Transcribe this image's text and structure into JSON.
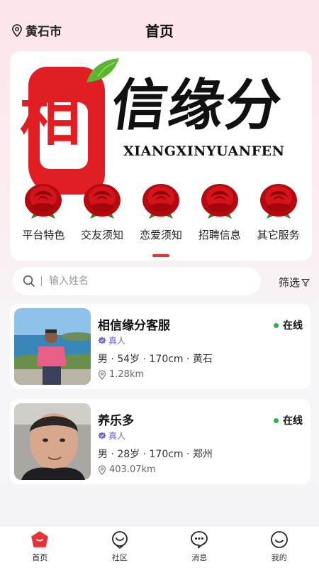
{
  "header": {
    "location": "黄石市",
    "title": "首页"
  },
  "banner": {
    "seal_char": "相",
    "title": "信缘分",
    "pinyin": "XIANGXINYUANFEN"
  },
  "menu": {
    "items": [
      {
        "label": "平台特色",
        "icon": "rose-icon"
      },
      {
        "label": "交友须知",
        "icon": "rose-icon"
      },
      {
        "label": "恋爱须知",
        "icon": "rose-icon"
      },
      {
        "label": "招聘信息",
        "icon": "rose-icon"
      },
      {
        "label": "其它服务",
        "icon": "rose-icon"
      }
    ]
  },
  "search": {
    "placeholder": "输入姓名",
    "filter_label": "筛选"
  },
  "users": [
    {
      "name": "相信缘分客服",
      "badge": "真人",
      "details": "男 · 54岁 · 170cm · 黄石",
      "distance": "1.28km",
      "status": "在线"
    },
    {
      "name": "养乐多",
      "badge": "真人",
      "details": "男 · 28岁 · 170cm · 郑州",
      "distance": "403.07km",
      "status": "在线"
    }
  ],
  "tabs": [
    {
      "label": "首页",
      "icon": "home-icon"
    },
    {
      "label": "社区",
      "icon": "community-icon"
    },
    {
      "label": "消息",
      "icon": "message-icon"
    },
    {
      "label": "我的",
      "icon": "profile-icon"
    }
  ],
  "colors": {
    "accent": "#e6333a",
    "online": "#27b34a",
    "verified": "#7b61c9"
  }
}
